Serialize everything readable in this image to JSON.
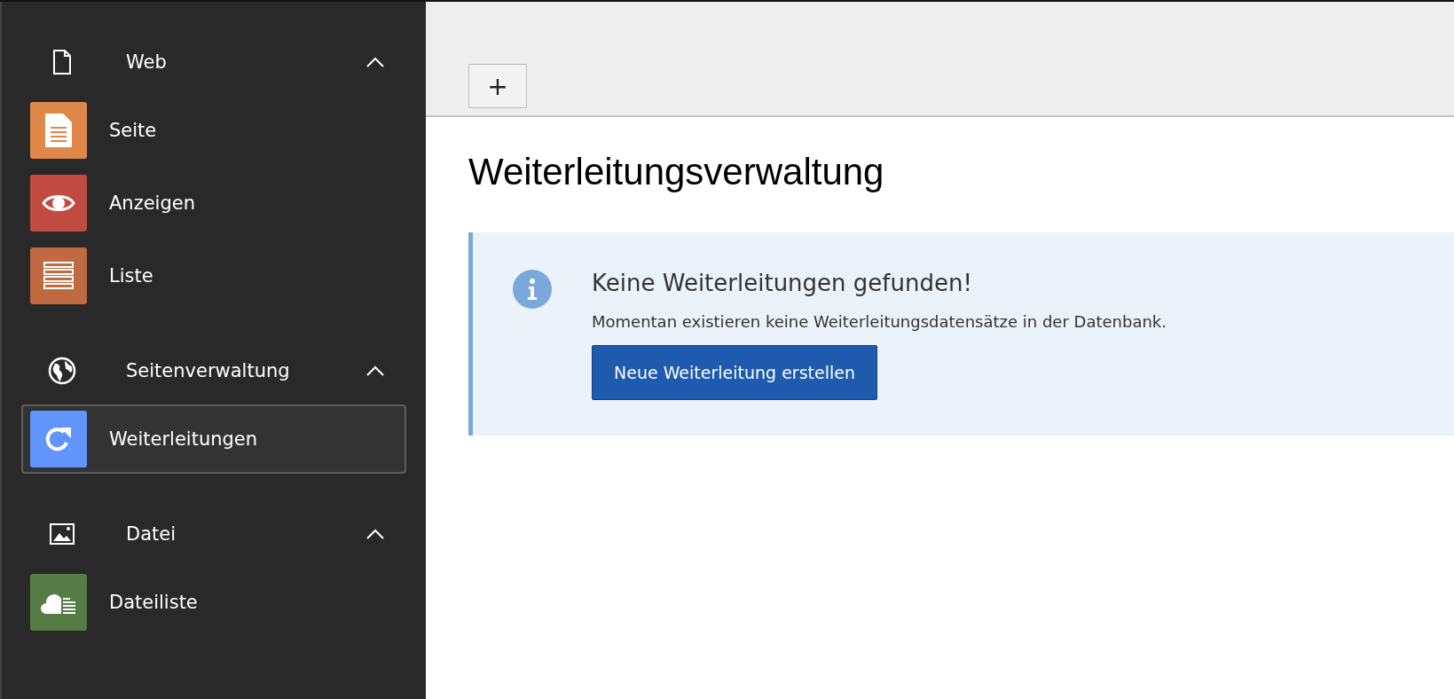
{
  "sidebar": {
    "groups": [
      {
        "label": "Web",
        "expanded": true,
        "items": [
          {
            "label": "Seite",
            "color": "#e0884a",
            "selected": false
          },
          {
            "label": "Anzeigen",
            "color": "#c24b41",
            "selected": false
          },
          {
            "label": "Liste",
            "color": "#bf6a41",
            "selected": false
          }
        ]
      },
      {
        "label": "Seitenverwaltung",
        "expanded": true,
        "items": [
          {
            "label": "Weiterleitungen",
            "color": "#6195fb",
            "selected": true
          }
        ]
      },
      {
        "label": "Datei",
        "expanded": true,
        "items": [
          {
            "label": "Dateiliste",
            "color": "#567c45",
            "selected": false
          }
        ]
      }
    ]
  },
  "toolbar": {
    "buttons": [
      "+"
    ]
  },
  "page": {
    "title": "Weiterleitungsverwaltung",
    "callout": {
      "title": "Keine Weiterleitungen gefunden!",
      "text": "Momentan existieren keine Weiterleitungsdatensätze in der Datenbank.",
      "button": "Neue Weiterleitung erstellen"
    }
  }
}
